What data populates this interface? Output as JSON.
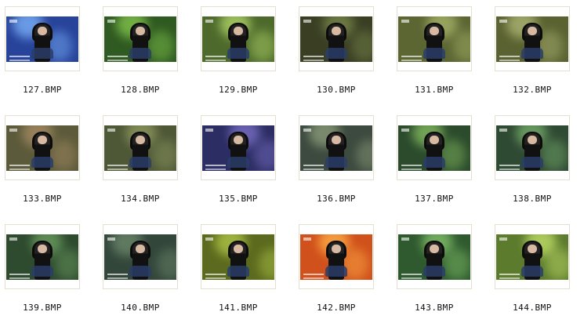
{
  "thumbnails": [
    {
      "file": "127.BMP",
      "bg": "#27439a",
      "spot": "#7fb7ff"
    },
    {
      "file": "128.BMP",
      "bg": "#2f5a21",
      "spot": "#86c94e"
    },
    {
      "file": "129.BMP",
      "bg": "#4d6a2c",
      "spot": "#b4d96a"
    },
    {
      "file": "130.BMP",
      "bg": "#3a3f24",
      "spot": "#7a8a4c"
    },
    {
      "file": "131.BMP",
      "bg": "#5b6633",
      "spot": "#a9b66a"
    },
    {
      "file": "132.BMP",
      "bg": "#5a6231",
      "spot": "#b1b978"
    },
    {
      "file": "133.BMP",
      "bg": "#5b5a3a",
      "spot": "#a98d66"
    },
    {
      "file": "134.BMP",
      "bg": "#4e5736",
      "spot": "#909b62"
    },
    {
      "file": "135.BMP",
      "bg": "#2c2d63",
      "spot": "#7d72c9"
    },
    {
      "file": "136.BMP",
      "bg": "#3c4a3f",
      "spot": "#8ea07c"
    },
    {
      "file": "137.BMP",
      "bg": "#2b4b2c",
      "spot": "#88bf63"
    },
    {
      "file": "138.BMP",
      "bg": "#2f4a33",
      "spot": "#79b06e"
    },
    {
      "file": "139.BMP",
      "bg": "#2e4a2f",
      "spot": "#6ea061"
    },
    {
      "file": "140.BMP",
      "bg": "#33463a",
      "spot": "#6e8b6e"
    },
    {
      "file": "141.BMP",
      "bg": "#5b6a1e",
      "spot": "#b2c94a"
    },
    {
      "file": "142.BMP",
      "bg": "#d0511b",
      "spot": "#ffb24a"
    },
    {
      "file": "143.BMP",
      "bg": "#2f5a2f",
      "spot": "#86c56b"
    },
    {
      "file": "144.BMP",
      "bg": "#5c7b2d",
      "spot": "#c5e36b"
    }
  ]
}
